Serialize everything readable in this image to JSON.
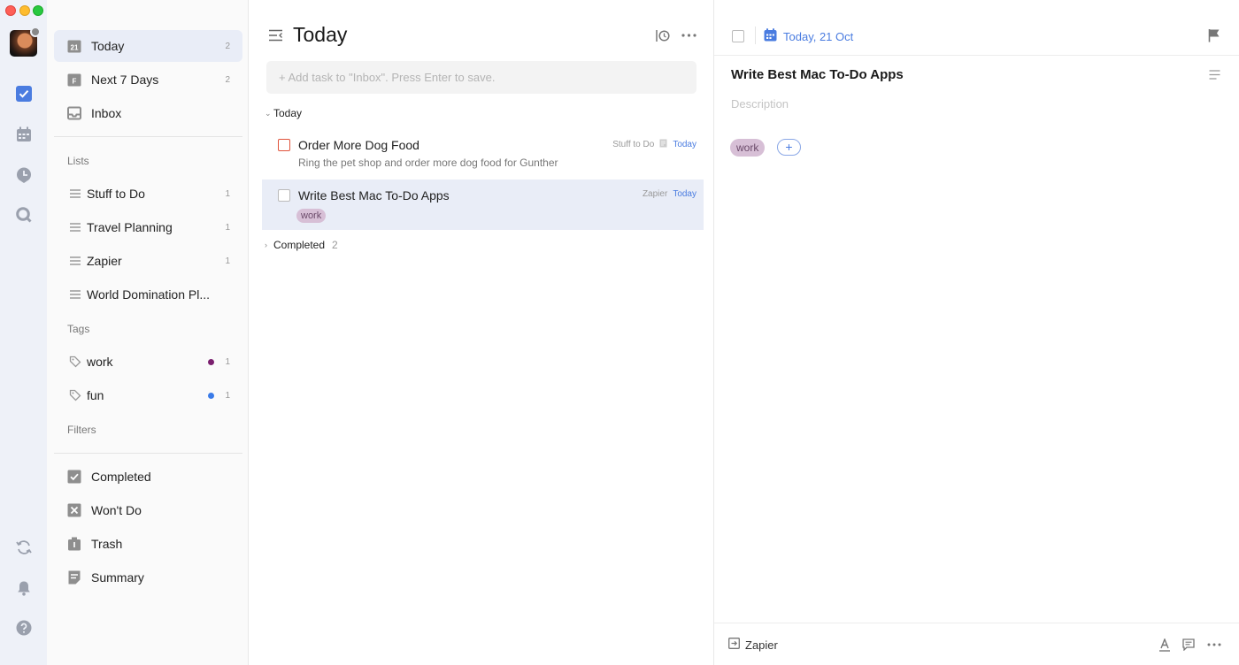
{
  "colors": {
    "accent": "#4a7ce0",
    "rail_bg": "#eef1f8",
    "tag_work": "#7a1f6e",
    "tag_fun": "#3a7be8",
    "priority_red": "#e0533b",
    "tag_pill": "#d7bfd6"
  },
  "rail": {
    "icons": [
      "checkbox-icon",
      "calendar-icon",
      "pomodoro-icon",
      "search-icon",
      "sync-icon",
      "bell-icon",
      "help-icon"
    ]
  },
  "sidebar": {
    "smart": [
      {
        "label": "Today",
        "count": "2",
        "icon": "calendar-today-icon"
      },
      {
        "label": "Next 7 Days",
        "count": "2",
        "icon": "calendar-week-icon"
      },
      {
        "label": "Inbox",
        "count": "",
        "icon": "inbox-icon"
      }
    ],
    "lists_title": "Lists",
    "lists": [
      {
        "label": "Stuff to Do",
        "count": "1"
      },
      {
        "label": "Travel Planning",
        "count": "1"
      },
      {
        "label": "Zapier",
        "count": "1"
      },
      {
        "label": "World Domination Pl...",
        "count": ""
      }
    ],
    "tags_title": "Tags",
    "tags": [
      {
        "label": "work",
        "count": "1",
        "color": "#7a1f6e"
      },
      {
        "label": "fun",
        "count": "1",
        "color": "#3a7be8"
      }
    ],
    "filters_title": "Filters",
    "system": [
      {
        "label": "Completed",
        "icon": "completed-icon"
      },
      {
        "label": "Won't Do",
        "icon": "wont-do-icon"
      },
      {
        "label": "Trash",
        "icon": "trash-icon"
      },
      {
        "label": "Summary",
        "icon": "summary-icon"
      }
    ]
  },
  "main": {
    "title": "Today",
    "add_placeholder": "+ Add task to \"Inbox\". Press Enter to save.",
    "group_today": "Today",
    "tasks": [
      {
        "title": "Order More Dog Food",
        "note": "Ring the pet shop and order more dog food for Gunther",
        "list": "Stuff to Do",
        "date": "Today",
        "tag": ""
      },
      {
        "title": "Write Best Mac To-Do Apps",
        "note": "",
        "list": "Zapier",
        "date": "Today",
        "tag": "work"
      }
    ],
    "completed_label": "Completed",
    "completed_count": "2"
  },
  "detail": {
    "date": "Today, 21 Oct",
    "title": "Write Best Mac To-Do Apps",
    "description_placeholder": "Description",
    "tag": "work",
    "add_tag": "+",
    "list": "Zapier"
  }
}
